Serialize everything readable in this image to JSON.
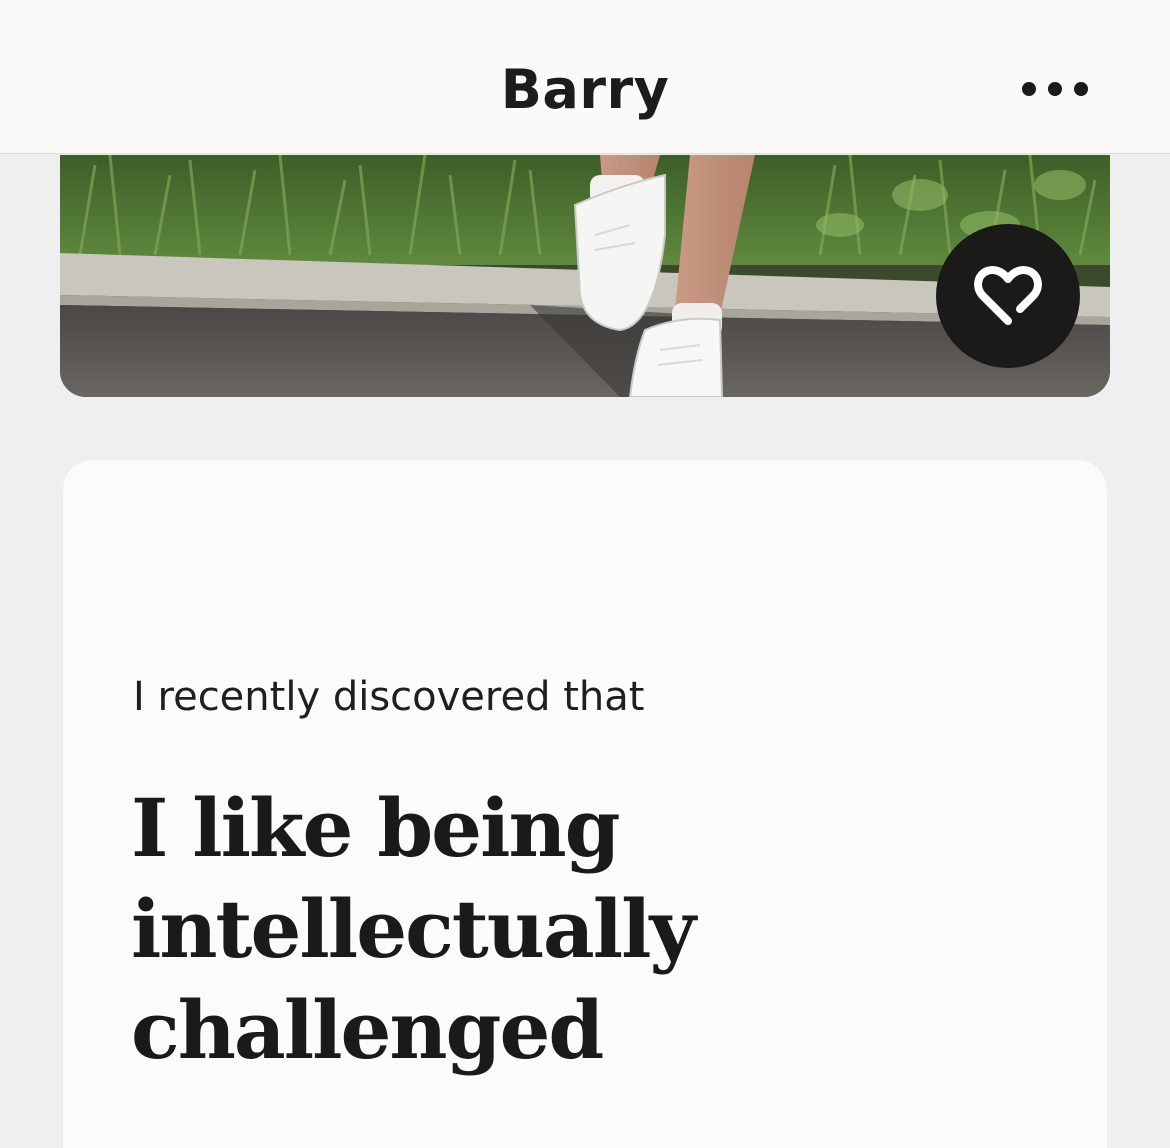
{
  "header": {
    "title": "Barry",
    "more_icon": "more-horizontal-icon"
  },
  "photo": {
    "description_icon": "profile-photo",
    "like_icon": "heart-icon",
    "colors": {
      "grass": "#4f7a34",
      "curb": "#c9c6bd",
      "road": "#5b5753",
      "like_button_bg": "#1b1a19"
    }
  },
  "prompt": {
    "question": "I recently discovered that",
    "answer_lines": [
      "I like being",
      "intellectually",
      "challenged"
    ]
  }
}
